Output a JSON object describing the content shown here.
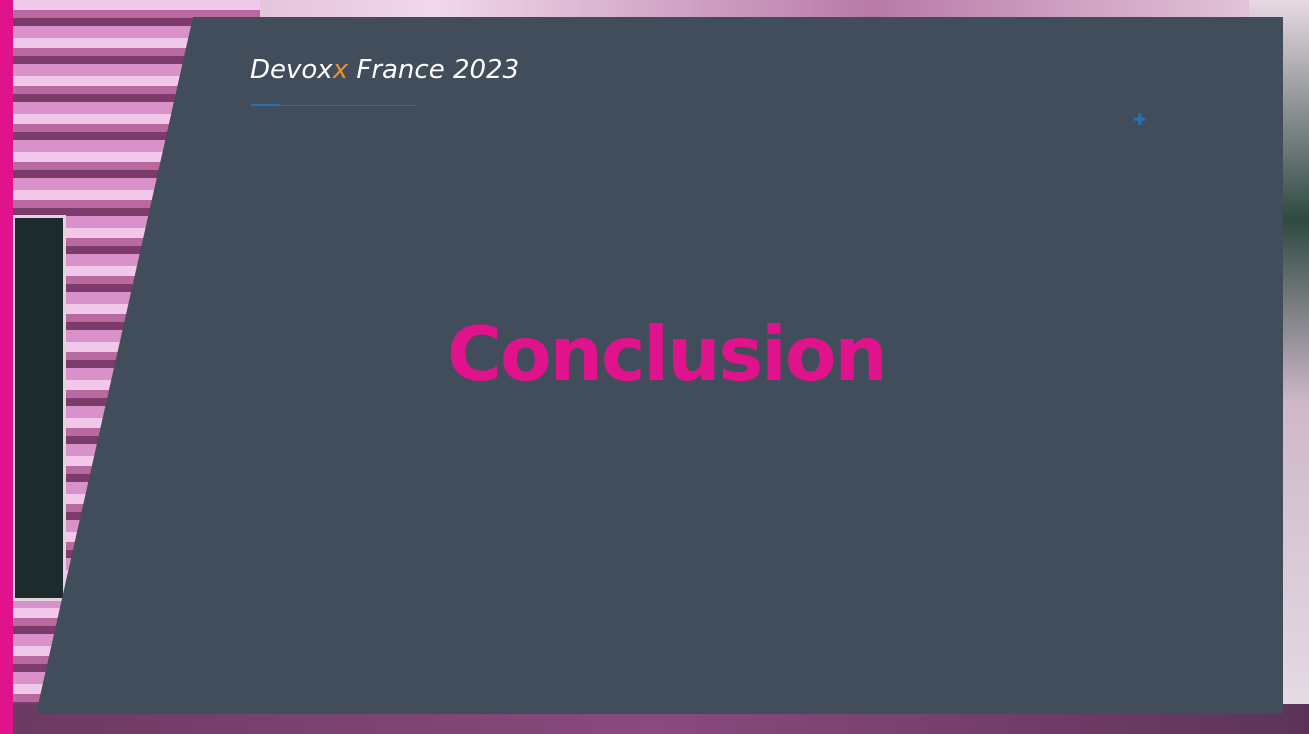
{
  "slide": {
    "header": {
      "brand_prefix": "Devox",
      "brand_accent": "x",
      "brand_suffix": " France 2023"
    },
    "title": "Conclusion"
  },
  "colors": {
    "accent_pink": "#e0138c",
    "panel": "#424d5c",
    "brand_orange": "#f29022",
    "accent_blue": "#2a6fb0"
  },
  "icons": {
    "decoration": "plus-icon"
  }
}
